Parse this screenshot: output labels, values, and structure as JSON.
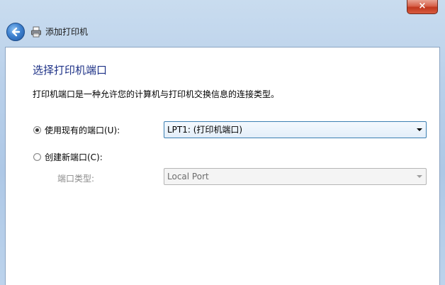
{
  "window": {
    "title": "添加打印机",
    "close_glyph": "×"
  },
  "page": {
    "heading": "选择打印机端口",
    "description": "打印机端口是一种允许您的计算机与打印机交换信息的连接类型。"
  },
  "options": {
    "use_existing": {
      "label": "使用现有的端口(U):",
      "checked": true,
      "selected_value": "LPT1: (打印机端口)"
    },
    "create_new": {
      "label": "创建新端口(C):",
      "checked": false,
      "port_type_label": "端口类型:",
      "port_type_value": "Local Port"
    }
  },
  "icons": [
    "back-arrow-icon",
    "printer-icon",
    "close-icon",
    "dropdown-arrow-icon"
  ],
  "colors": {
    "heading": "#1e3287",
    "close_button": "#c0381f",
    "back_button": "#3f82d0"
  }
}
